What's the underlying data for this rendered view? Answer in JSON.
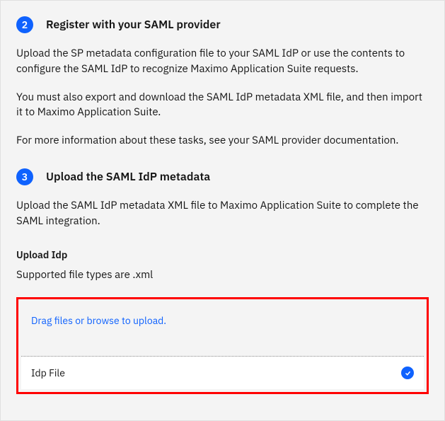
{
  "step2": {
    "number": "2",
    "title": "Register with your SAML provider",
    "desc1": "Upload the SP metadata configuration file to your SAML IdP or use the contents to configure the SAML IdP to recognize Maximo Application Suite requests.",
    "desc2": "You must also export and download the SAML IdP metadata XML file, and then import it to Maximo Application Suite.",
    "desc3": "For more information about these tasks, see your SAML provider documentation."
  },
  "step3": {
    "number": "3",
    "title": "Upload the SAML IdP metadata",
    "desc1": "Upload the SAML IdP metadata XML file to Maximo Application Suite to complete the SAML integration."
  },
  "upload": {
    "section_label": "Upload Idp",
    "supported": "Supported file types are .xml",
    "dropzone_text": "Drag files or browse to upload.",
    "file_name": "Idp File"
  }
}
